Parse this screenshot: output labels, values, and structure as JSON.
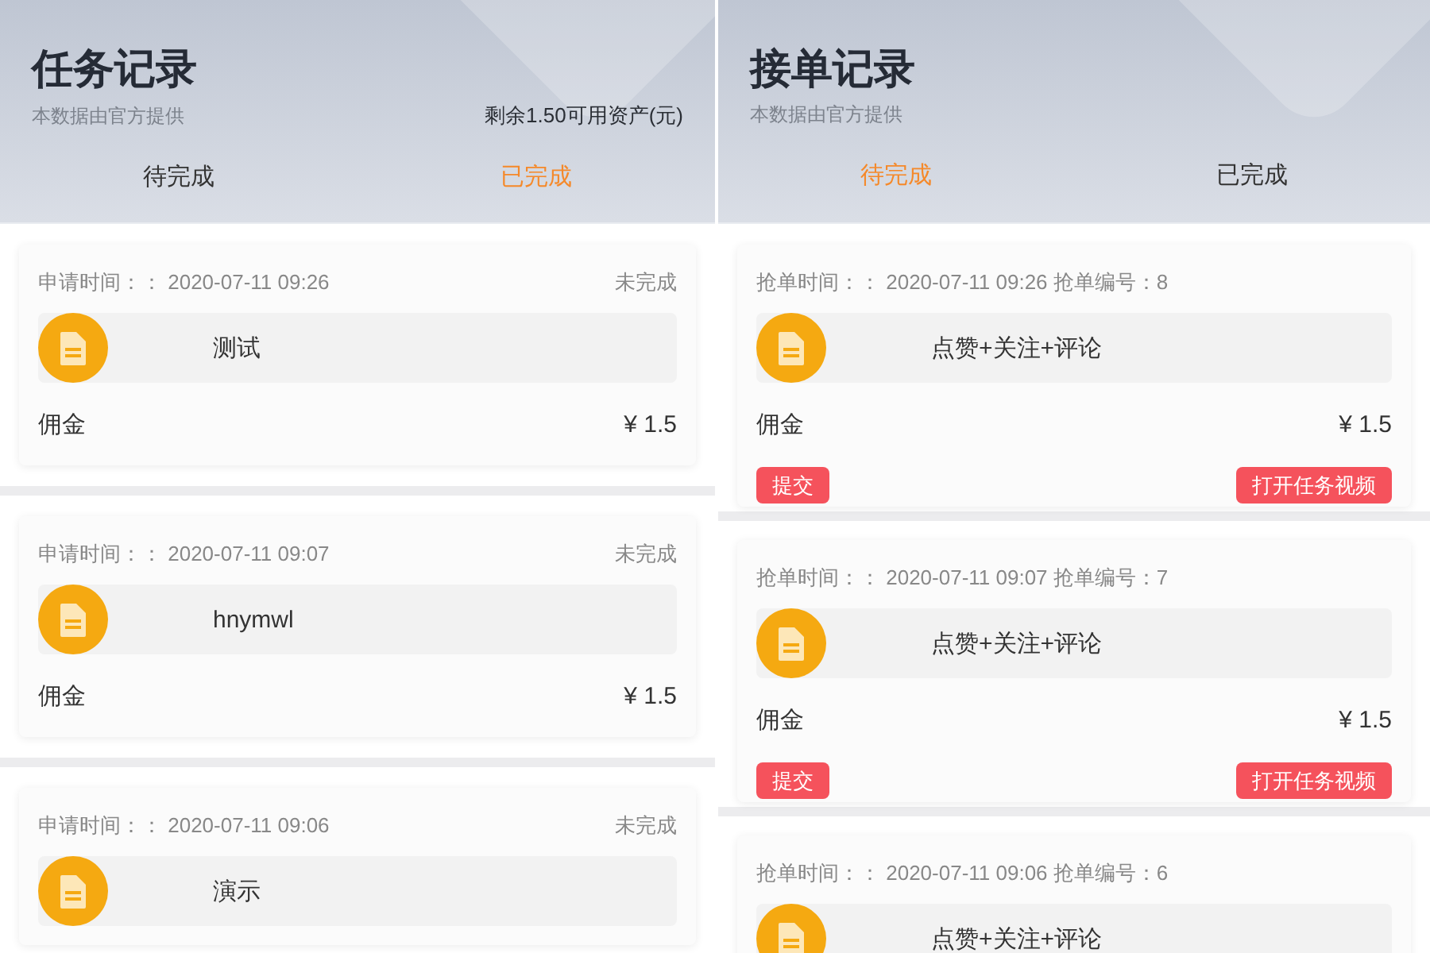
{
  "panels": [
    {
      "title": "任务记录",
      "subtitle": "本数据由官方提供",
      "balance": "剩余1.50可用资产(元)",
      "tabs": [
        {
          "label": "待完成",
          "selected": false
        },
        {
          "label": "已完成",
          "selected": true
        }
      ],
      "cards": [
        {
          "time": "申请时间：： 2020-07-11 09:26",
          "status": "未完成",
          "task": "测试",
          "commission_label": "佣金",
          "commission": "¥ 1.5"
        },
        {
          "time": "申请时间：： 2020-07-11 09:07",
          "status": "未完成",
          "task": "hnymwl",
          "commission_label": "佣金",
          "commission": "¥ 1.5"
        },
        {
          "time": "申请时间：： 2020-07-11 09:06",
          "status": "未完成",
          "task": "演示"
        }
      ]
    },
    {
      "title": "接单记录",
      "subtitle": "本数据由官方提供",
      "tabs": [
        {
          "label": "待完成",
          "selected": true
        },
        {
          "label": "已完成",
          "selected": false
        }
      ],
      "cards": [
        {
          "time": "抢单时间：： 2020-07-11 09:26 抢单编号：8",
          "task": "点赞+关注+评论",
          "commission_label": "佣金",
          "commission": "¥ 1.5",
          "buttons": [
            "提交",
            "打开任务视频"
          ]
        },
        {
          "time": "抢单时间：： 2020-07-11 09:07 抢单编号：7",
          "task": "点赞+关注+评论",
          "commission_label": "佣金",
          "commission": "¥ 1.5",
          "buttons": [
            "提交",
            "打开任务视频"
          ]
        },
        {
          "time": "抢单时间：： 2020-07-11 09:06 抢单编号：6",
          "task": "点赞+关注+评论"
        }
      ]
    }
  ]
}
